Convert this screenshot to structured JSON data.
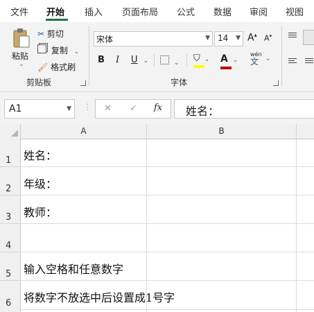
{
  "menu": {
    "tabs": [
      "文件",
      "开始",
      "插入",
      "页面布局",
      "公式",
      "数据",
      "审阅",
      "视图"
    ],
    "active_index": 1
  },
  "ribbon": {
    "clipboard": {
      "paste_label": "粘贴",
      "cut_label": "剪切",
      "copy_label": "复制",
      "format_painter_label": "格式刷",
      "group_label": "剪贴板"
    },
    "font": {
      "font_name": "宋体",
      "font_size": "14",
      "grow_label": "A",
      "shrink_label": "A",
      "bold_label": "B",
      "italic_label": "I",
      "underline_label": "U",
      "font_color_label": "A",
      "phonetic_label": "wén",
      "phonetic_char": "文",
      "group_label": "字体",
      "fill_color": "#FFFF00",
      "font_color": "#C00000"
    }
  },
  "formula_bar": {
    "name_box": "A1",
    "cancel_symbol": "✕",
    "enter_symbol": "✓",
    "fx_label": "fx",
    "content": "姓名："
  },
  "sheet": {
    "columns": [
      "A",
      "B"
    ],
    "rows": [
      {
        "number": "1",
        "a": "姓名："
      },
      {
        "number": "2",
        "a": "年级："
      },
      {
        "number": "3",
        "a": "教师："
      },
      {
        "number": "4",
        "a": ""
      },
      {
        "number": "5",
        "a": "输入空格和任意数字"
      },
      {
        "number": "6",
        "a": "将数字不放选中后设置成1号字"
      }
    ]
  },
  "colors": {
    "accent": "#217346"
  }
}
